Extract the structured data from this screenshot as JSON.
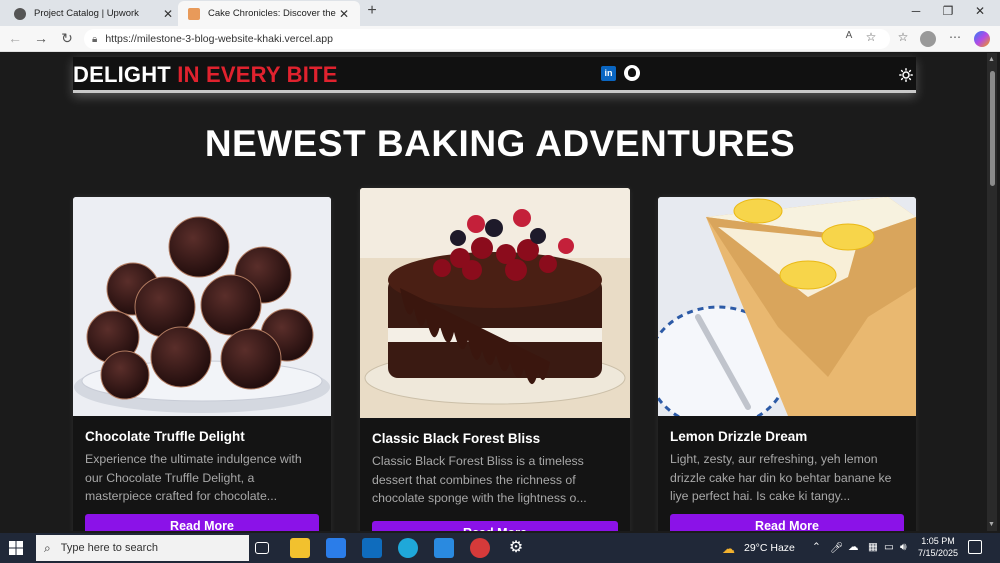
{
  "browser": {
    "tabs": [
      {
        "title": "Project Catalog | Upwork",
        "active": false
      },
      {
        "title": "Cake Chronicles: Discover the Art",
        "active": true
      }
    ],
    "url": "https://milestone-3-blog-website-khaki.vercel.app"
  },
  "site": {
    "logo_main": "DELIGHT",
    "logo_accent": "IN EVERY BITE",
    "linkedin_label": "in",
    "headline": "NEWEST BAKING ADVENTURES",
    "cards": [
      {
        "title": "Chocolate Truffle Delight",
        "excerpt": "Experience the ultimate indulgence with our Chocolate Truffle Delight, a masterpiece crafted for chocolate...",
        "button": "Read More"
      },
      {
        "title": "Classic Black Forest Bliss",
        "excerpt": "Classic Black Forest Bliss is a timeless dessert that combines the richness of chocolate sponge with the lightness o...",
        "button": "Read More"
      },
      {
        "title": "Lemon Drizzle Dream",
        "excerpt": "Light, zesty, aur refreshing, yeh lemon drizzle cake har din ko behtar banane ke liye perfect hai. Is cake ki tangy...",
        "button": "Read More"
      }
    ]
  },
  "taskbar": {
    "search_placeholder": "Type here to search",
    "weather": "29°C Haze",
    "time": "1:05 PM",
    "date": "7/15/2025"
  },
  "colors": {
    "accent": "#e0222e",
    "button": "#8b12e8",
    "background": "#1b1b1b"
  }
}
